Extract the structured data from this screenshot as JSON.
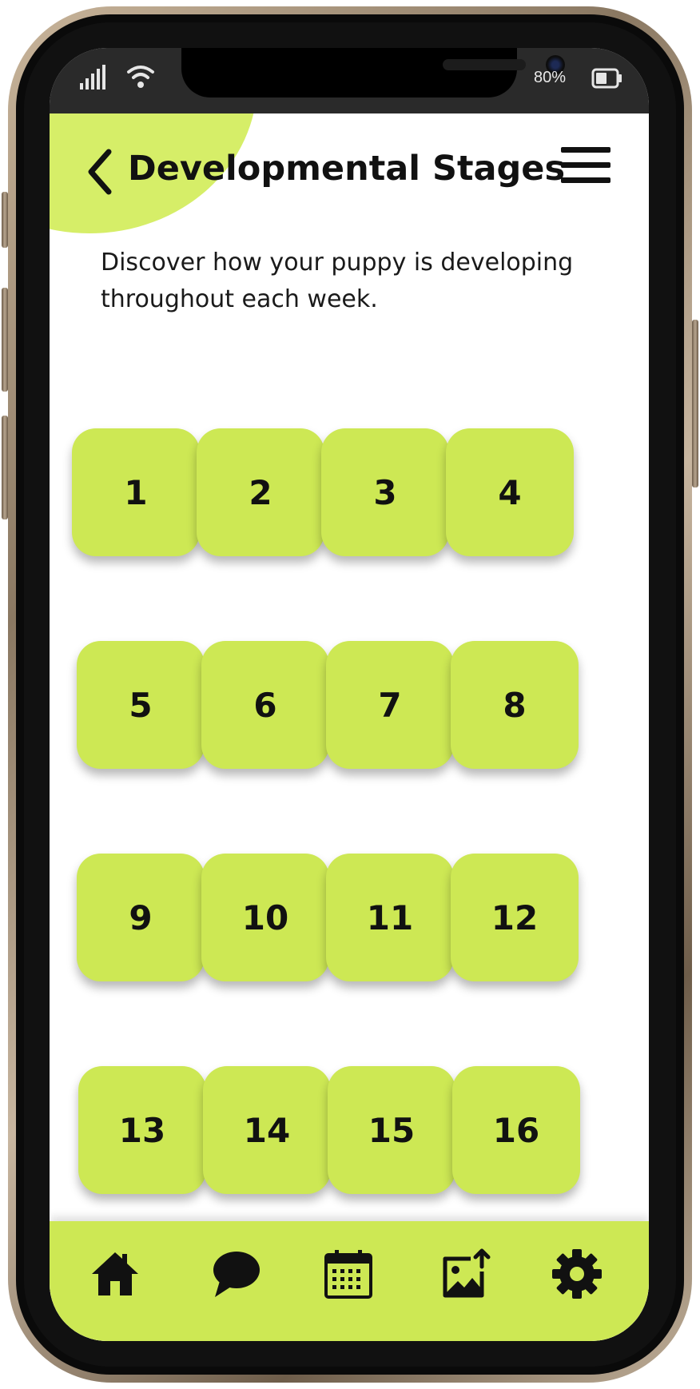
{
  "status_bar": {
    "battery_level": "80%",
    "icons": [
      "signal-icon",
      "wifi-icon",
      "battery-icon"
    ]
  },
  "header": {
    "title": "Developmental Stages",
    "back_icon": "chevron-left-icon",
    "menu_icon": "hamburger-menu-icon"
  },
  "intro_text": "Discover how your puppy is developing throughout each week.",
  "weeks": [
    "1",
    "2",
    "3",
    "4",
    "5",
    "6",
    "7",
    "8",
    "9",
    "10",
    "11",
    "12",
    "13",
    "14",
    "15",
    "16"
  ],
  "bottom_nav": {
    "items": [
      {
        "icon": "home-icon"
      },
      {
        "icon": "chat-bubble-icon"
      },
      {
        "icon": "calendar-icon"
      },
      {
        "icon": "image-upload-icon"
      },
      {
        "icon": "gear-icon"
      }
    ]
  },
  "colors": {
    "accent": "#cde854",
    "accent_light": "#d6ee68",
    "text": "#111111",
    "status_bar": "#2a2a2a"
  }
}
